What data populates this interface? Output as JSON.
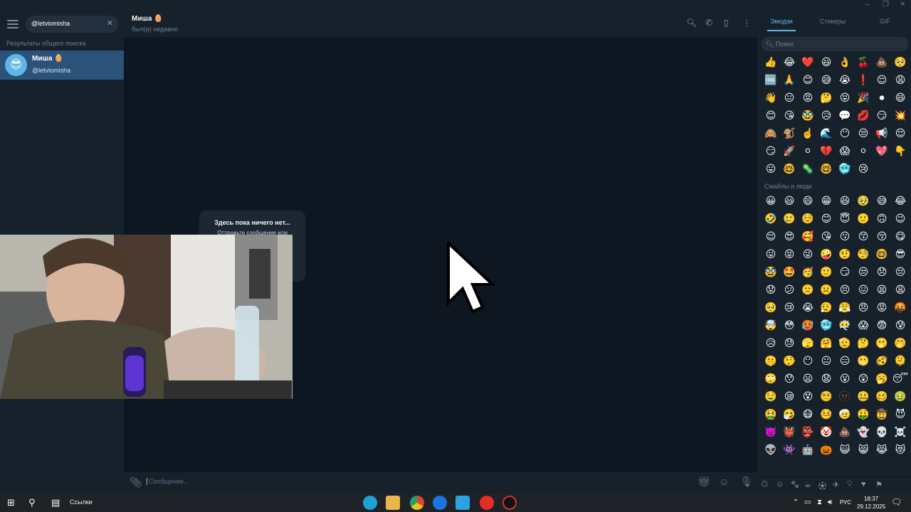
{
  "window": {
    "minimize": "–",
    "maximize": "❐",
    "close": "✕"
  },
  "sidebar": {
    "search_value": "@letviomisha",
    "section_label": "Результаты общего поиска",
    "result": {
      "name": "Миша 🥚",
      "username": "@letviomisha",
      "avatar": "😎"
    }
  },
  "chat": {
    "name": "Миша 🥚",
    "status": "был(а) недавно",
    "empty_title": "Здесь пока ничего нет...",
    "empty_sub": "Отправьте сообщение или нажмите на приветствие ниже.",
    "input_placeholder": "Сообщение..."
  },
  "emoji_panel": {
    "tabs": [
      "Эмодзи",
      "Стикеры",
      "GIF"
    ],
    "search_placeholder": "Поиск",
    "category_label": "Смайлы и люди",
    "recent": [
      "👍",
      "😂",
      "❤️",
      "😃",
      "👌",
      "🍒",
      "💩",
      "🥺",
      "🆒",
      "🙏",
      "😊",
      "😅",
      "😭",
      "❗",
      "😌",
      "😩",
      "👋",
      "😐",
      "😡",
      "🤔",
      "😝",
      "🎉",
      "⏺",
      "😄",
      "😊",
      "😘",
      "🥸",
      "😥",
      "💬",
      "💋",
      "😏",
      "💥",
      "🙈",
      "🐒",
      "☝️",
      "🌊",
      "😶",
      "😒",
      "📢",
      "😌",
      "😏",
      "🚀",
      "⚪",
      "💔",
      "😱",
      "⚪",
      "💖",
      "👇",
      "😛",
      "🤓",
      "🦠",
      "🤓",
      "🥶",
      "😢"
    ],
    "smileys": [
      "😀",
      "😃",
      "😄",
      "😁",
      "😆",
      "🥹",
      "😅",
      "😂",
      "🤣",
      "🥲",
      "☺️",
      "😊",
      "😇",
      "🙂",
      "🙃",
      "😉",
      "😌",
      "😍",
      "🥰",
      "😘",
      "😗",
      "😙",
      "😚",
      "😋",
      "😛",
      "😝",
      "😜",
      "🤪",
      "🤨",
      "🧐",
      "🤓",
      "😎",
      "🥸",
      "🤩",
      "🥳",
      "🙂",
      "😏",
      "😒",
      "😞",
      "😔",
      "😟",
      "😕",
      "🙁",
      "☹️",
      "😣",
      "😖",
      "😫",
      "😩",
      "🥺",
      "😢",
      "😭",
      "😮‍💨",
      "😤",
      "😠",
      "😡",
      "🤬",
      "🤯",
      "😳",
      "🥵",
      "🥶",
      "😶‍🌫️",
      "😱",
      "😨",
      "😰",
      "😥",
      "😓",
      "🫣",
      "🤗",
      "🫡",
      "🤔",
      "🫢",
      "🤭",
      "🤫",
      "🤥",
      "😶",
      "😐",
      "😑",
      "😬",
      "🫨",
      "🫠",
      "🙄",
      "😯",
      "😦",
      "😧",
      "😮",
      "😲",
      "🥱",
      "😴",
      "🤤",
      "😪",
      "😵",
      "😵‍💫",
      "🫥",
      "🤐",
      "🥴",
      "🤢",
      "🤮",
      "🤧",
      "😷",
      "🤒",
      "🤕",
      "🤑",
      "🤠",
      "😈",
      "👿",
      "👹",
      "👺",
      "🤡",
      "💩",
      "👻",
      "💀",
      "☠️",
      "👽",
      "👾",
      "🤖",
      "🎃",
      "😺",
      "😸",
      "😹",
      "😻",
      "😼",
      "😽",
      "🙀",
      "😿",
      "😾"
    ]
  },
  "taskbar": {
    "search_label": "Ссылки",
    "lang": "РУС",
    "time": "18:37",
    "date": "29.12.2025"
  }
}
